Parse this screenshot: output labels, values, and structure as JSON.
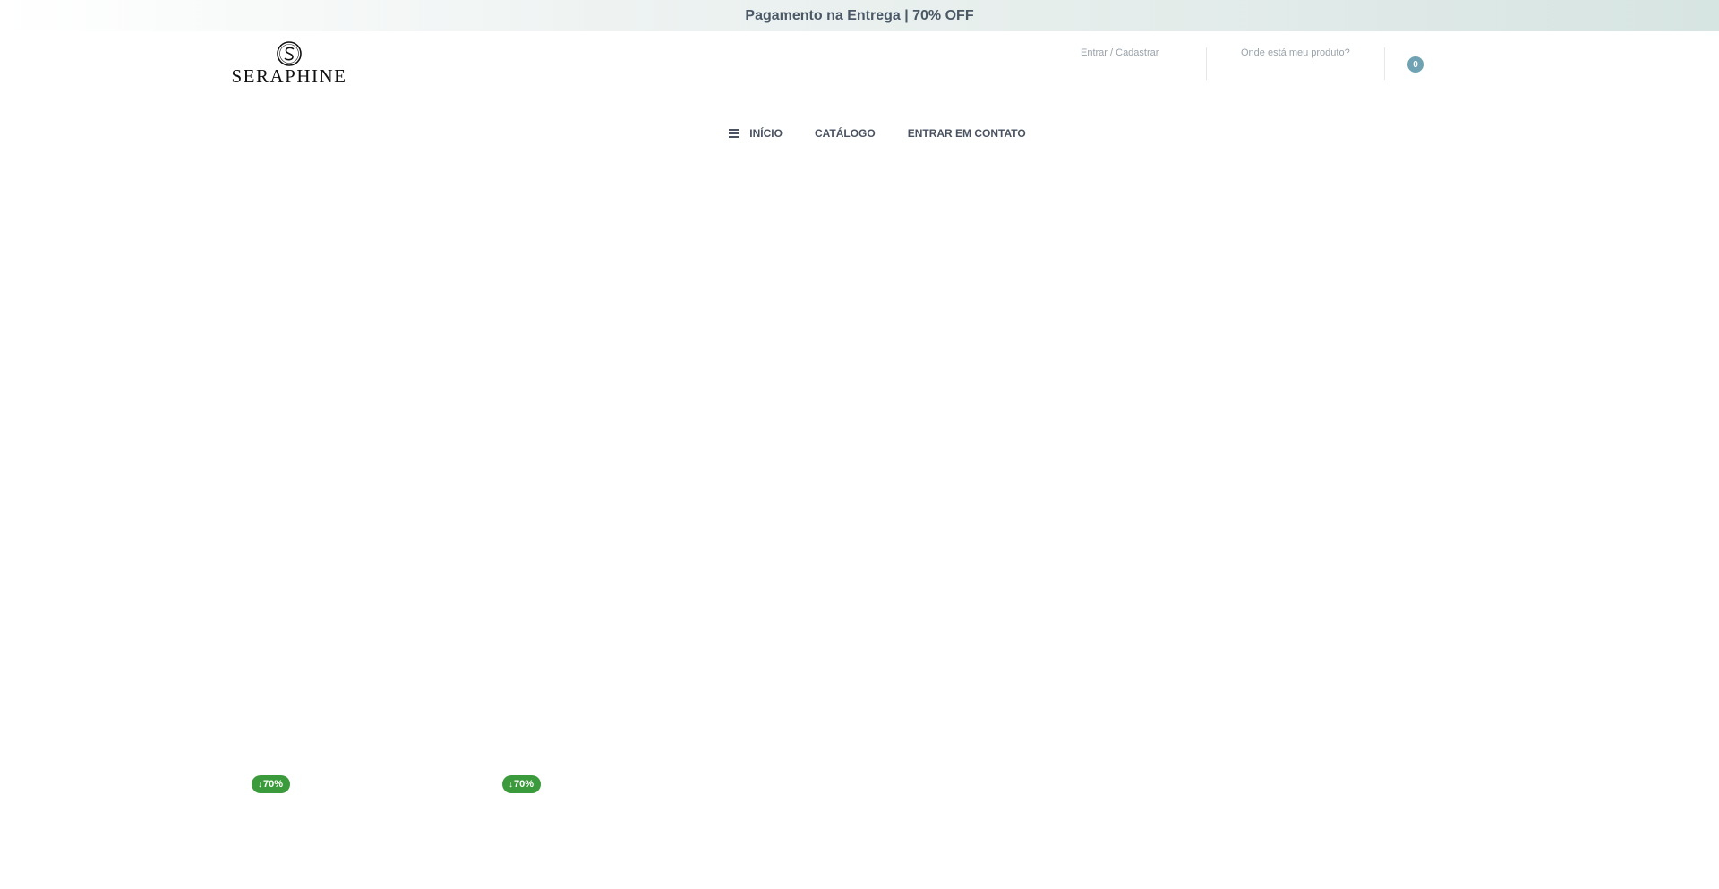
{
  "announcement": {
    "text": "Pagamento na Entrega | 70% OFF"
  },
  "header": {
    "logo": {
      "wordmark": "SERAPHINE",
      "monogram": "S"
    },
    "login_link": "Entrar / Cadastrar",
    "track_link": "Onde está meu produto?",
    "cart": {
      "count": "0",
      "badge_color": "#6fa3b3"
    }
  },
  "nav": {
    "items": [
      {
        "label": "INÍCIO",
        "icon": "menu-icon"
      },
      {
        "label": "CATÁLOGO"
      },
      {
        "label": "ENTRAR EM CONTATO"
      }
    ]
  },
  "products": {
    "badges": [
      {
        "arrow": "↓",
        "label": "70%"
      },
      {
        "arrow": "↓",
        "label": "70%"
      }
    ],
    "badge_color": "#3b9a3b"
  }
}
